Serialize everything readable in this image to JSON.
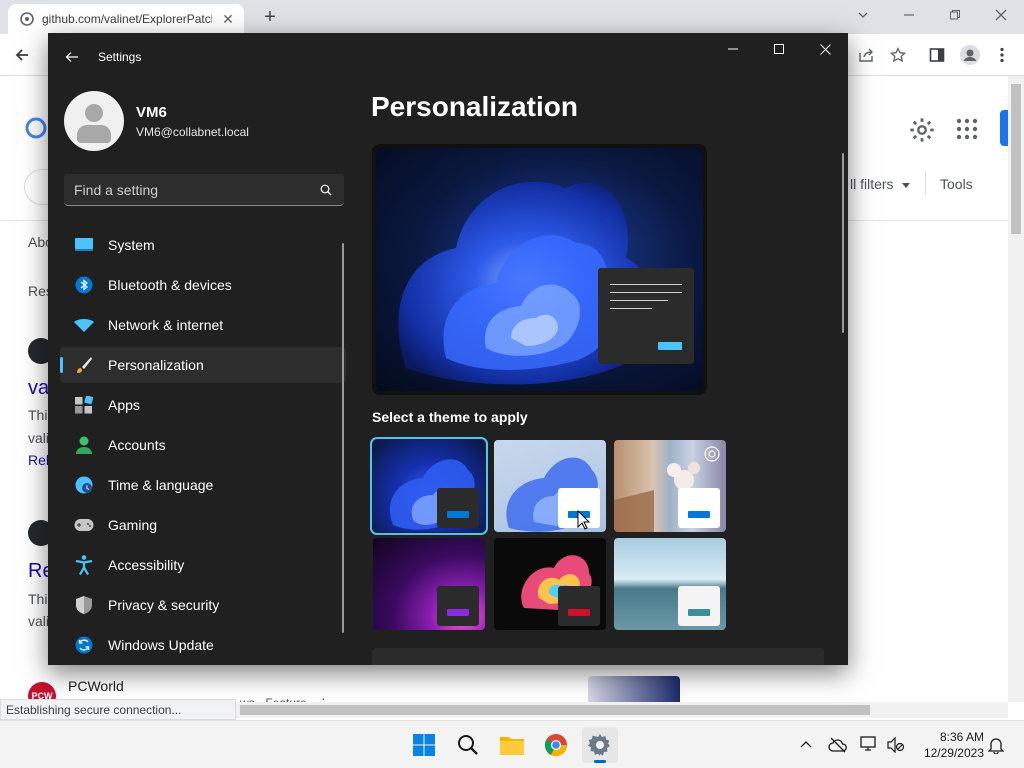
{
  "browser": {
    "tab_title": "github.com/valinet/ExplorerPatcher",
    "tab_close": "✕",
    "new_tab": "+",
    "status": "Establishing secure connection..."
  },
  "background_page": {
    "filters_label": "ll filters",
    "tools_label": "Tools",
    "partial_texts": [
      "Abo",
      "Res",
      "val",
      "Thi",
      "vali",
      "Rel",
      "Re",
      "Thi",
      "vali"
    ],
    "pcworld": "PCWorld",
    "pcworld_sub": "ws · Feature · ⋮"
  },
  "settings": {
    "window_title": "Settings",
    "user": {
      "name": "VM6",
      "email": "VM6@collabnet.local"
    },
    "search": {
      "placeholder": "Find a setting"
    },
    "nav": [
      {
        "label": "System",
        "icon": "system-icon"
      },
      {
        "label": "Bluetooth & devices",
        "icon": "bluetooth-icon"
      },
      {
        "label": "Network & internet",
        "icon": "network-icon"
      },
      {
        "label": "Personalization",
        "icon": "personalization-brush-icon",
        "active": true
      },
      {
        "label": "Apps",
        "icon": "apps-icon"
      },
      {
        "label": "Accounts",
        "icon": "accounts-icon"
      },
      {
        "label": "Time & language",
        "icon": "time-language-icon"
      },
      {
        "label": "Gaming",
        "icon": "gaming-icon"
      },
      {
        "label": "Accessibility",
        "icon": "accessibility-icon"
      },
      {
        "label": "Privacy & security",
        "icon": "privacy-shield-icon"
      },
      {
        "label": "Windows Update",
        "icon": "windows-update-icon"
      }
    ],
    "page_title": "Personalization",
    "themes_label": "Select a theme to apply",
    "themes": [
      {
        "name": "windows-dark",
        "selected": true,
        "chip": "#0078d4"
      },
      {
        "name": "windows-light",
        "selected": false,
        "chip": "#0078d4"
      },
      {
        "name": "windows-spotlight",
        "selected": false,
        "chip": "#0078d4"
      },
      {
        "name": "glow",
        "selected": false,
        "chip": "#8a2be2"
      },
      {
        "name": "captured-motion",
        "selected": false,
        "chip": "#d0102a"
      },
      {
        "name": "flow",
        "selected": false,
        "chip": "#3a8f9a"
      }
    ]
  },
  "taskbar": {
    "time": "8:36 AM",
    "date": "12/29/2023"
  },
  "colors": {
    "accent": "#4cc2ff",
    "settings_bg": "#202020",
    "chrome_tabbar": "#dee1e6"
  }
}
